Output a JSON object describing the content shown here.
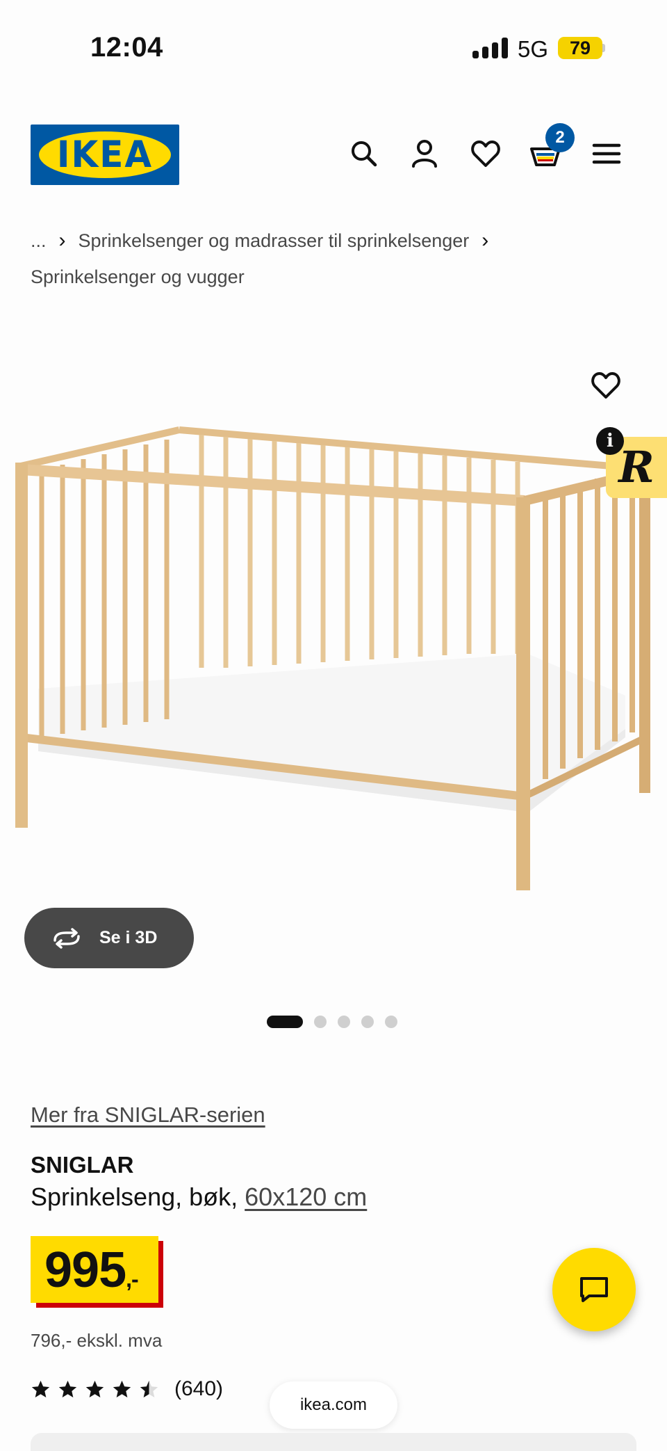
{
  "status_bar": {
    "time": "12:04",
    "network": "5G",
    "battery": "79"
  },
  "header": {
    "logo_text": "IKEA",
    "cart_count": "2"
  },
  "breadcrumb": {
    "ellipsis": "...",
    "level1": "Sprinkelsenger og madrasser til sprinkelsenger",
    "level2": "Sprinkelsenger og vugger"
  },
  "gallery": {
    "view_3d_label": "Se i 3D",
    "image_count": 5,
    "active_index": 0
  },
  "product": {
    "series_link": "Mer fra SNIGLAR-serien",
    "name": "SNIGLAR",
    "description": "Sprinkelseng, bøk, ",
    "size": "60x120 cm",
    "price": "995",
    "price_suffix": ",-",
    "price_ex_vat": "796,- ekskl. mva",
    "rating": 4.5,
    "rating_count": "(640)"
  },
  "browser": {
    "url": "ikea.com"
  },
  "colors": {
    "ikea_blue": "#0058a3",
    "ikea_yellow": "#ffdb00",
    "price_red": "#cc0008",
    "wood": "#e3c291"
  }
}
